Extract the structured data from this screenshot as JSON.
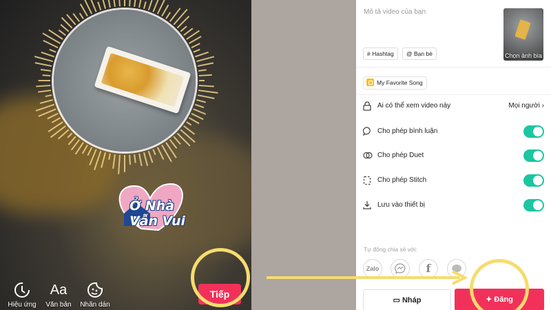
{
  "editor": {
    "watermark_line1": "Ở Nhà",
    "watermark_line2": "Vẫn Vui",
    "tools": [
      {
        "label": "Hiệu ứng",
        "icon": "effects-timer-icon"
      },
      {
        "label": "Văn bản",
        "icon": "text-aa-icon"
      },
      {
        "label": "Nhãn dán",
        "icon": "sticker-icon"
      }
    ],
    "next_label": "Tiếp"
  },
  "post": {
    "description_placeholder": "Mô tả video của bạn",
    "chips": [
      {
        "label": "Hashtag",
        "icon": "hashtag-icon"
      },
      {
        "label": "Bạn bè",
        "icon": "at-icon"
      }
    ],
    "cover_label": "Chọn ảnh bìa",
    "song": "My Favorite Song",
    "privacy": {
      "label": "Ai có thể xem video này",
      "value": "Mọi người"
    },
    "toggles": [
      {
        "label": "Cho phép bình luận",
        "icon": "comment-icon",
        "on": true
      },
      {
        "label": "Cho phép Duet",
        "icon": "duet-icon",
        "on": true
      },
      {
        "label": "Cho phép Stitch",
        "icon": "stitch-icon",
        "on": true
      },
      {
        "label": "Lưu vào thiết bị",
        "icon": "download-icon",
        "on": true
      }
    ],
    "autoshare_label": "Tự động chia sẻ với:",
    "share_targets": [
      "Zalo",
      "messenger-icon",
      "facebook-icon",
      "message-icon"
    ],
    "draft_label": "Nháp",
    "post_label": "Đăng"
  },
  "colors": {
    "accent_red": "#f2315a",
    "toggle_green": "#1bc6a1",
    "highlight_yellow": "#f6dc6e",
    "music_yellow": "#fbbf1c"
  }
}
